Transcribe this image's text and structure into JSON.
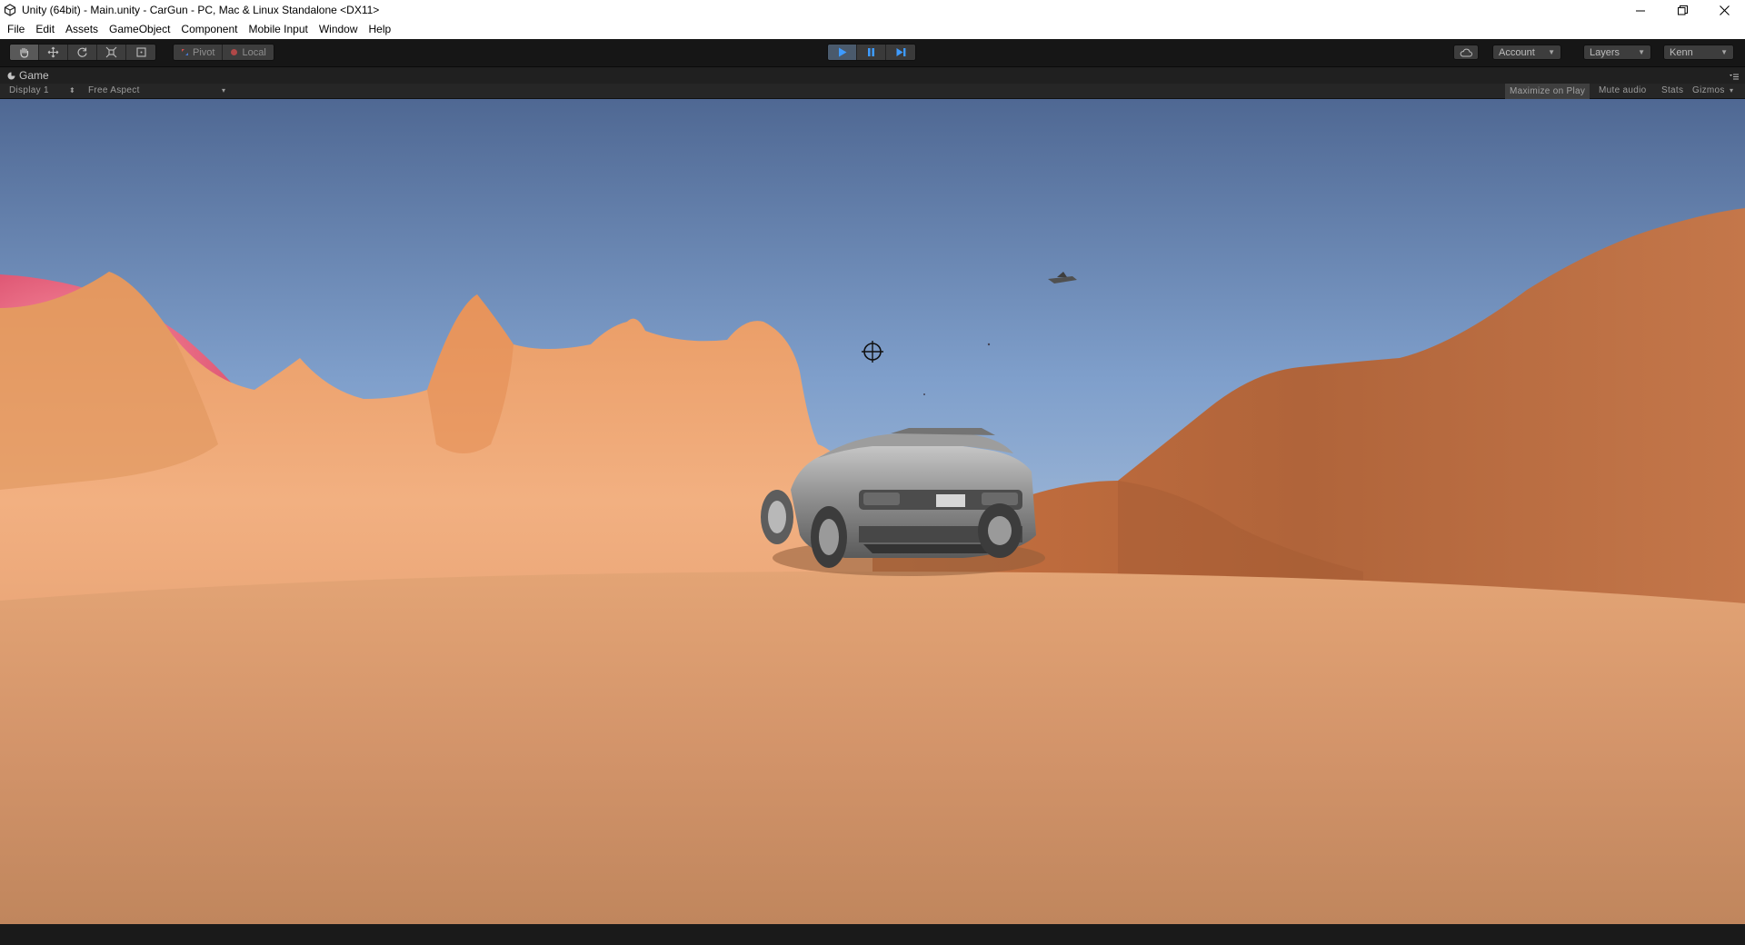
{
  "window": {
    "title": "Unity (64bit) - Main.unity - CarGun - PC, Mac & Linux Standalone <DX11>",
    "controls": [
      "minimize-icon",
      "restore-icon",
      "close-icon"
    ]
  },
  "menu": {
    "items": [
      "File",
      "Edit",
      "Assets",
      "GameObject",
      "Component",
      "Mobile Input",
      "Window",
      "Help"
    ]
  },
  "toolbar": {
    "transform_tools": [
      "hand-tool-icon",
      "move-tool-icon",
      "rotate-tool-icon",
      "scale-tool-icon",
      "rect-tool-icon"
    ],
    "pivot_label": "Pivot",
    "local_label": "Local",
    "play_controls": [
      "play-icon",
      "pause-icon",
      "step-icon"
    ],
    "account_label": "Account",
    "layers_label": "Layers",
    "layout_label": "Kenn"
  },
  "game_panel": {
    "tab_label": "Game",
    "display_label": "Display 1",
    "aspect_label": "Free Aspect",
    "maximize_label": "Maximize on Play",
    "mute_label": "Mute audio",
    "stats_label": "Stats",
    "gizmos_label": "Gizmos"
  },
  "colors": {
    "sky_top": "#4f6893",
    "sky_bottom": "#9bb6d6",
    "sand": "#d89567",
    "dune_light": "#f0a672",
    "dune_dark": "#a85e36",
    "pink_dome": "#e25a78",
    "play_active": "#4a5a6c",
    "play_icon": "#3e9bff"
  }
}
